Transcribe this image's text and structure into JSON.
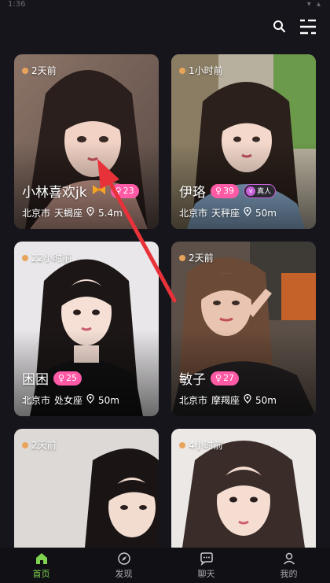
{
  "status": {
    "time": "1:36",
    "icons": "▾ ▴"
  },
  "cards": [
    {
      "time": "2天前",
      "name": "小林喜欢jk",
      "age": "23",
      "location": "北京市",
      "zodiac": "天蝎座",
      "distance": "5.4m",
      "verified": false
    },
    {
      "time": "1小时前",
      "name": "伊珞",
      "age": "39",
      "location": "北京市",
      "zodiac": "天秤座",
      "distance": "50m",
      "verified": true,
      "verified_label": "真人"
    },
    {
      "time": "22小时前",
      "name": "困困",
      "age": "25",
      "location": "北京市",
      "zodiac": "处女座",
      "distance": "50m",
      "verified": false
    },
    {
      "time": "2天前",
      "name": "敏子",
      "age": "27",
      "location": "北京市",
      "zodiac": "摩羯座",
      "distance": "50m",
      "verified": false
    },
    {
      "time": "2天前"
    },
    {
      "time": "4小时前"
    }
  ],
  "nav": [
    {
      "label": "首页",
      "icon": "home-icon",
      "active": true
    },
    {
      "label": "发现",
      "icon": "compass-icon",
      "active": false
    },
    {
      "label": "聊天",
      "icon": "chat-bubble-icon",
      "active": false
    },
    {
      "label": "我的",
      "icon": "person-icon",
      "active": false
    }
  ],
  "colors": {
    "background": "#16151c",
    "accent_green": "#7fd34e",
    "badge_pink": "#ff5aa5",
    "annotation_arrow": "#e8323a"
  }
}
